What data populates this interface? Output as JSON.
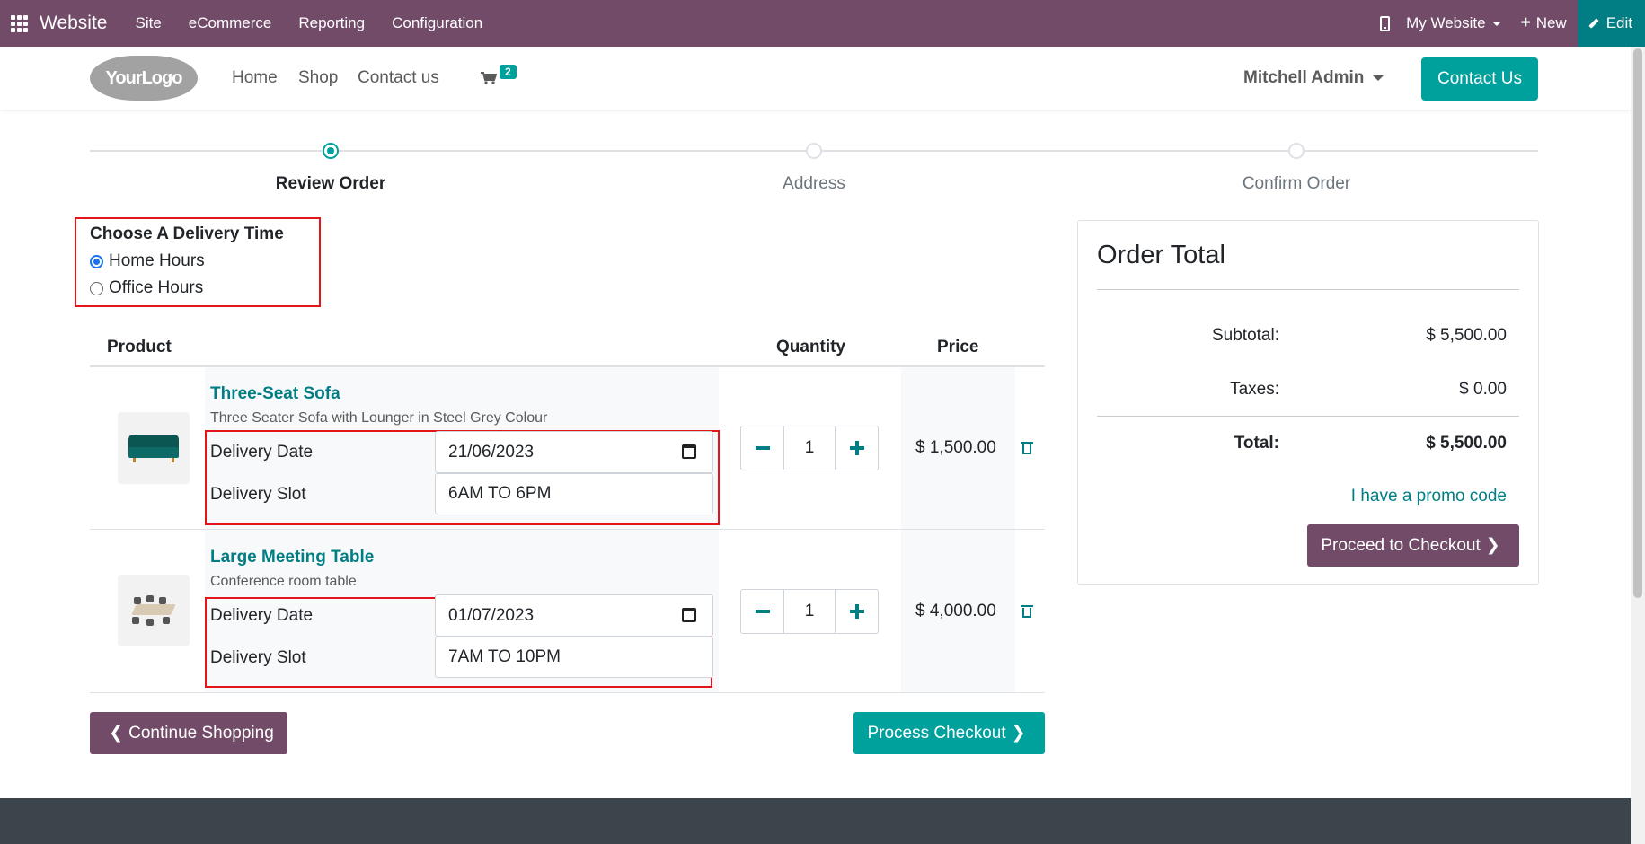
{
  "admin_bar": {
    "brand": "Website",
    "menus": [
      "Site",
      "eCommerce",
      "Reporting",
      "Configuration"
    ],
    "website_selector": "My Website",
    "new_label": "New",
    "edit_label": "Edit",
    "color": "#714b67",
    "edit_color": "#017e84"
  },
  "header": {
    "logo_text": "YourLogo",
    "nav": [
      "Home",
      "Shop",
      "Contact us"
    ],
    "cart_count": "2",
    "user": "Mitchell Admin",
    "contact_button": "Contact Us"
  },
  "progress": {
    "steps": [
      "Review Order",
      "Address",
      "Confirm Order"
    ],
    "active_step": "Review Order"
  },
  "delivery_time": {
    "title": "Choose A Delivery Time",
    "options": [
      "Home Hours",
      "Office Hours"
    ],
    "selected": "Home Hours"
  },
  "cart": {
    "headers": {
      "product": "Product",
      "quantity": "Quantity",
      "price": "Price"
    },
    "items": [
      {
        "name": "Three-Seat Sofa",
        "description": "Three Seater Sofa with Lounger in Steel Grey Colour",
        "date_label": "Delivery Date",
        "date_value": "21/06/2023",
        "slot_label": "Delivery Slot",
        "slot_value": "6AM TO 6PM",
        "quantity": "1",
        "price": "$ 1,500.00"
      },
      {
        "name": "Large Meeting Table",
        "description": "Conference room table",
        "date_label": "Delivery Date",
        "date_value": "01/07/2023",
        "slot_label": "Delivery Slot",
        "slot_value": "7AM TO 10PM",
        "quantity": "1",
        "price": "$ 4,000.00"
      }
    ],
    "continue_label": "Continue Shopping",
    "process_label": "Process Checkout"
  },
  "order_total": {
    "title": "Order Total",
    "subtotal_label": "Subtotal:",
    "subtotal": "$ 5,500.00",
    "taxes_label": "Taxes:",
    "taxes": "$ 0.00",
    "total_label": "Total:",
    "total": "$ 5,500.00",
    "promo_label": "I have a promo code",
    "checkout_label": "Proceed to Checkout"
  },
  "colors": {
    "primary": "#714b67",
    "accent": "#00a09d",
    "link": "#017e84",
    "highlight_border": "#e3151a"
  }
}
